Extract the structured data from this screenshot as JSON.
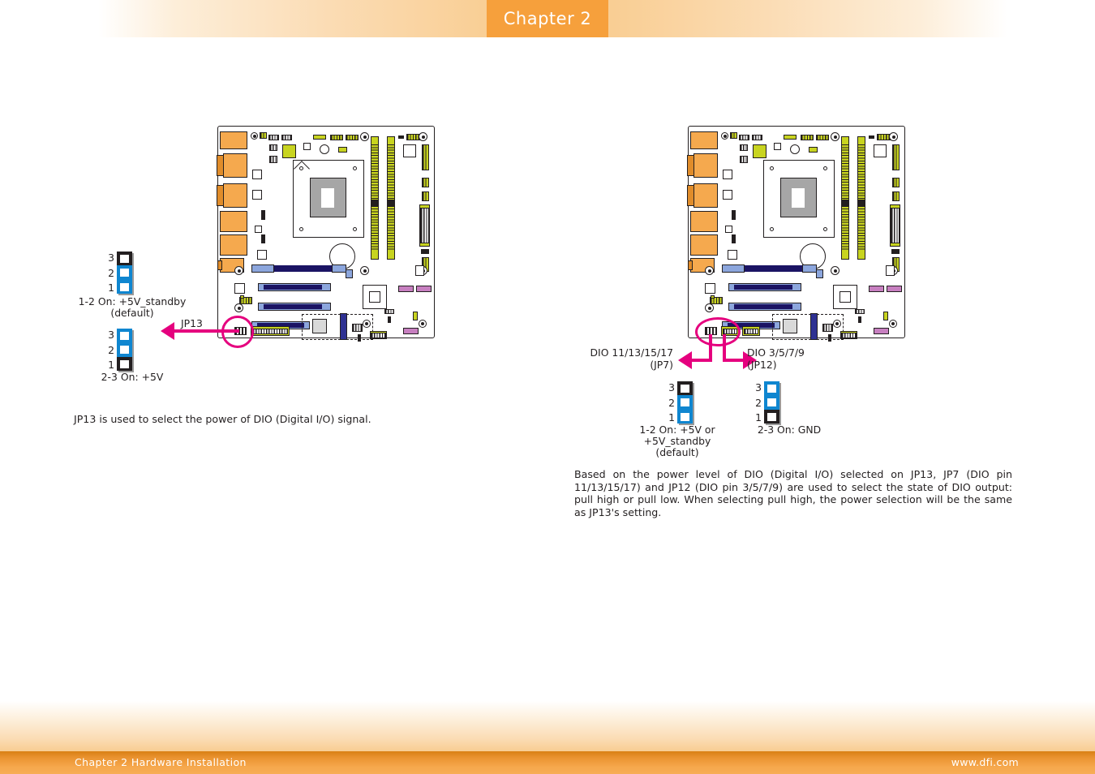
{
  "header": {
    "chapter_tab_label": "Chapter 2",
    "accent_color": "#f6a03c"
  },
  "footer": {
    "left_text": "Chapter 2 Hardware Installation",
    "right_text": "www.dfi.com",
    "bar_color": "#f6a84d"
  },
  "annotation_color": "#e5007e",
  "left_section": {
    "callout_label": "JP13",
    "jumper_top": {
      "pins": [
        "3",
        "2",
        "1"
      ],
      "segments": [
        "black",
        "blue",
        "blue"
      ],
      "caption": "1-2 On: +5V_standby\n(default)"
    },
    "jumper_bottom": {
      "pins": [
        "3",
        "2",
        "1"
      ],
      "segments": [
        "blue",
        "blue",
        "black"
      ],
      "caption": "2-3 On: +5V"
    },
    "description": "JP13 is used to select the power of DIO (Digital I/O) signal."
  },
  "right_section": {
    "callout_left_label": "DIO 11/13/15/17\n(JP7)",
    "callout_right_label": "DIO 3/5/7/9\n(JP12)",
    "jumper_left": {
      "pins": [
        "3",
        "2",
        "1"
      ],
      "segments": [
        "black",
        "blue",
        "blue"
      ],
      "caption": "1-2 On: +5V or\n+5V_standby\n(default)"
    },
    "jumper_right": {
      "pins": [
        "3",
        "2",
        "1"
      ],
      "segments": [
        "blue",
        "blue",
        "black"
      ],
      "caption": "2-3 On: GND"
    },
    "description": "Based on the power level of DIO (Digital I/O) selected on JP13, JP7 (DIO pin 11/13/15/17) and JP12 (DIO pin 3/5/7/9) are used to select the state of DIO output: pull high or pull low. When selecting pull high, the power selection will be the same as JP13's setting."
  },
  "board_colors": {
    "io_port": "#f5a94e",
    "dimm_slot": "#c8d420",
    "pcie_slot": "#2e3192",
    "pci_slot": "#8ca6dd",
    "sata_port": "#c77fc0",
    "outline": "#231f20"
  }
}
